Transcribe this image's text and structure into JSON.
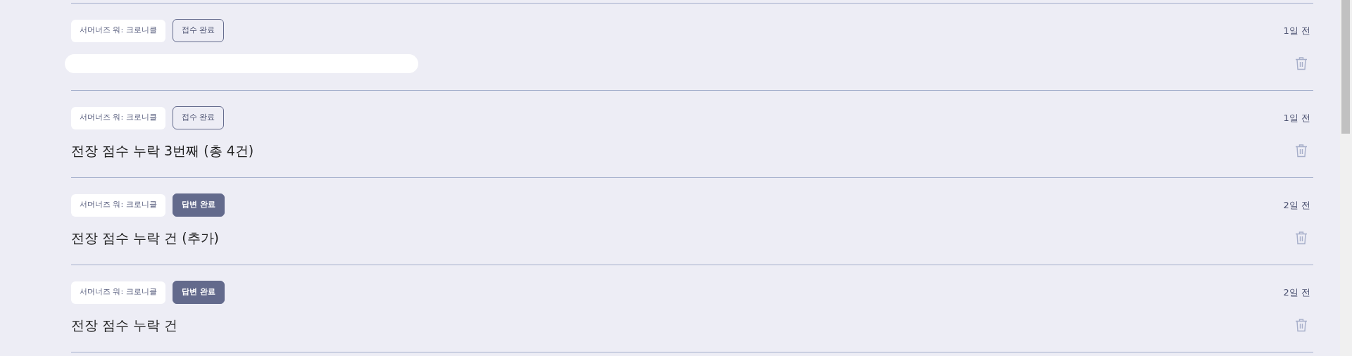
{
  "posts": [
    {
      "game": "서머너즈 워: 크로니클",
      "status": {
        "label": "접수 완료",
        "kind": "outline"
      },
      "redacted": true,
      "time": "1일 전"
    },
    {
      "game": "서머너즈 워: 크로니클",
      "status": {
        "label": "접수 완료",
        "kind": "outline"
      },
      "title": "전장 점수 누락 3번째 (총 4건)",
      "time": "1일 전"
    },
    {
      "game": "서머너즈 워: 크로니클",
      "status": {
        "label": "답변 완료",
        "kind": "filled"
      },
      "title": "전장 점수 누락 건 (추가)",
      "time": "2일 전"
    },
    {
      "game": "서머너즈 워: 크로니클",
      "status": {
        "label": "답변 완료",
        "kind": "filled"
      },
      "title": "전장 점수 누락 건",
      "time": "2일 전"
    }
  ]
}
